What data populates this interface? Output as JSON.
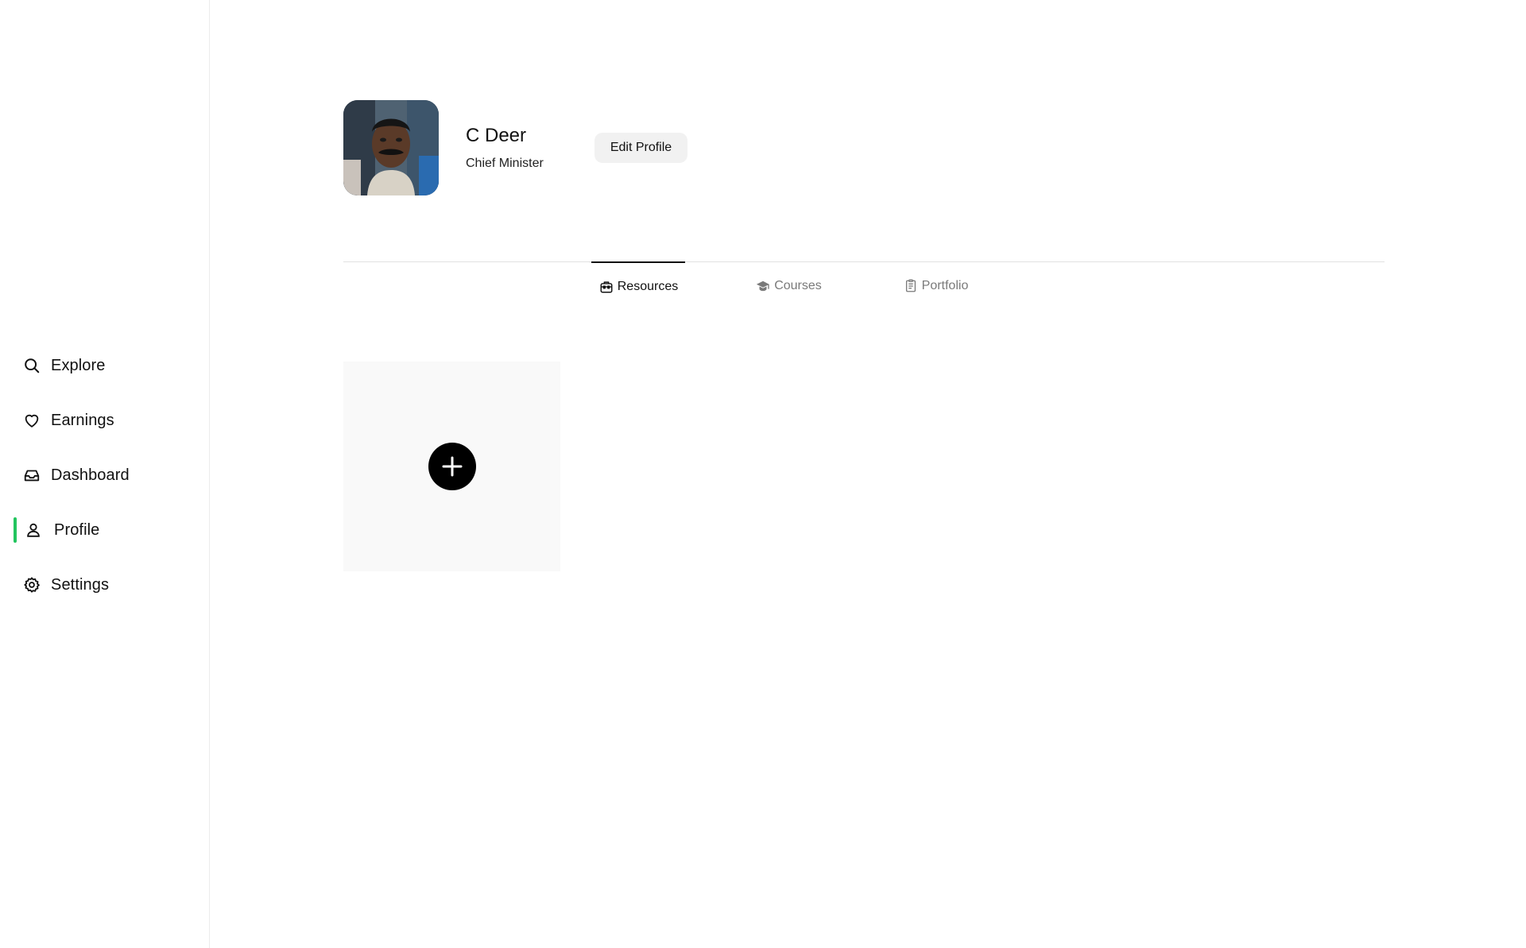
{
  "sidebar": {
    "items": [
      {
        "label": "Explore",
        "icon": "search-icon"
      },
      {
        "label": "Earnings",
        "icon": "heart-icon"
      },
      {
        "label": "Dashboard",
        "icon": "inbox-icon"
      },
      {
        "label": "Profile",
        "icon": "user-icon",
        "active": true
      },
      {
        "label": "Settings",
        "icon": "gear-icon"
      }
    ],
    "active_indicator_color": "#22c55e"
  },
  "profile": {
    "name": "C Deer",
    "role": "Chief Minister",
    "edit_label": "Edit Profile"
  },
  "tabs": [
    {
      "label": "Resources",
      "icon": "briefcase-icon",
      "active": true
    },
    {
      "label": "Courses",
      "icon": "graduation-cap-icon",
      "active": false
    },
    {
      "label": "Portfolio",
      "icon": "document-icon",
      "active": false
    }
  ],
  "content": {
    "add_card_icon": "plus-icon"
  }
}
